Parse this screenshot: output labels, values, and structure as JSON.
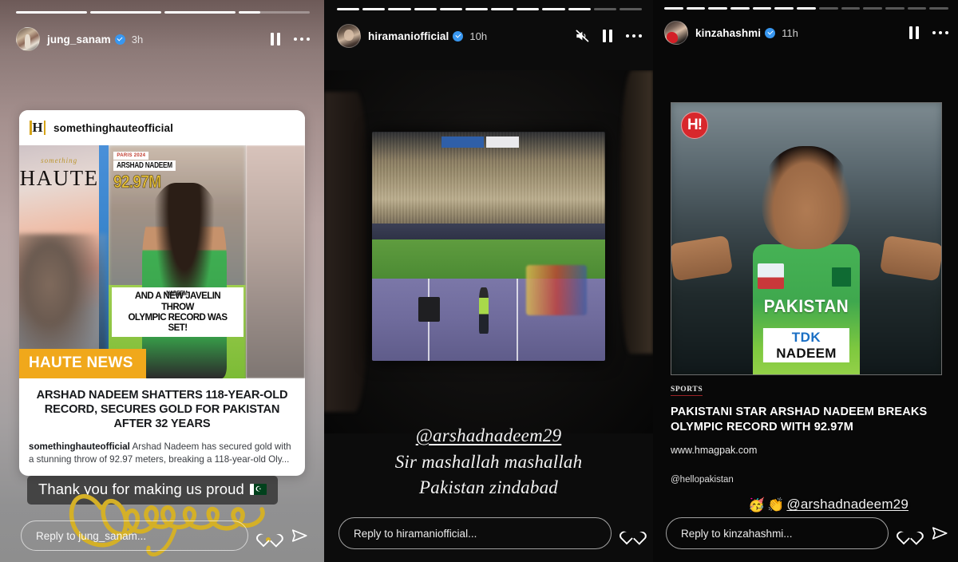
{
  "panels": [
    {
      "id": "story-jung-sanam",
      "progress": {
        "total": 4,
        "filled": 3,
        "partial_percent": 30
      },
      "header": {
        "username": "jung_sanam",
        "verified": true,
        "age": "3h",
        "avatar": "avatar-jung-sanam",
        "icons": [
          "pause-icon",
          "more-options-icon"
        ]
      },
      "repost_card": {
        "logo": "H",
        "account": "somethinghauteofficial",
        "magazine": {
          "script_word": "something",
          "title": "HAUTE",
          "badge": "PARIS 2024",
          "athlete_name": "ARSHAD NADEEM",
          "distance": "92.97M",
          "bib": "NADEEM",
          "caption_line1": "AND A NEW JAVELIN THROW",
          "caption_line2": "OLYMPIC RECORD WAS SET!"
        },
        "news_tag": "HAUTE NEWS",
        "headline": "ARSHAD NADEEM SHATTERS 118-YEAR-OLD RECORD, SECURES GOLD FOR PAKISTAN AFTER 32 YEARS",
        "caption_author": "somethinghauteofficial",
        "caption_text": " Arshad Nadeem has secured gold with a stunning throw of 92.97 meters, breaking a 118-year-old Oly..."
      },
      "sticker": {
        "text": "Thank you for making us proud",
        "emoji": "flag-pakistan"
      },
      "scrawl": {
        "text": "Congrats",
        "color": "#d4b027"
      },
      "reply": {
        "placeholder": "Reply to jung_sanam...",
        "icons": [
          "heart-icon",
          "send-icon"
        ]
      }
    },
    {
      "id": "story-hiramaniofficial",
      "progress": {
        "total": 12,
        "filled": 10,
        "partial_percent": 0
      },
      "header": {
        "username": "hiramaniofficial",
        "verified": true,
        "age": "10h",
        "avatar": "avatar-hiramaniofficial",
        "icons": [
          "mute-icon",
          "pause-icon",
          "more-options-icon"
        ]
      },
      "overlay_text": {
        "mention": "@arshadnadeem29",
        "line2": "Sir mashallah mashallah",
        "line3": "Pakistan zindabad"
      },
      "reply": {
        "placeholder": "Reply to hiramaniofficial...",
        "icons": [
          "heart-icon"
        ]
      }
    },
    {
      "id": "story-kinzahashmi",
      "progress": {
        "total": 13,
        "filled": 7,
        "partial_percent": 0
      },
      "header": {
        "username": "kinzahashmi",
        "verified": true,
        "age": "11h",
        "avatar": "avatar-kinzahashmi",
        "icons": [
          "pause-icon",
          "more-options-icon"
        ]
      },
      "article_card": {
        "logo": "H!",
        "photo_alt": "arshad-nadeem-celebrating",
        "jersey_country": "PAKISTAN",
        "sponsor": "TDK",
        "bib_name": "NADEEM",
        "kicker": "SPORTS",
        "headline": "PAKISTANI STAR ARSHAD NADEEM BREAKS OLYMPIC RECORD WITH 92.97M",
        "url": "www.hmagpak.com",
        "handle": "@hellopakistan"
      },
      "mention_sticker": {
        "emoji1": "🥳",
        "emoji2": "👏",
        "text": "@arshadnadeem29"
      },
      "reply": {
        "placeholder": "Reply to kinzahashmi...",
        "icons": [
          "heart-icon",
          "send-icon"
        ]
      }
    }
  ],
  "colors": {
    "accent_orange": "#f0a81b",
    "verified_blue": "#3897f0",
    "brand_red": "#d8272c",
    "scrawl_yellow": "#d4b027",
    "panel_bg_dark": "#0c0c0c"
  }
}
